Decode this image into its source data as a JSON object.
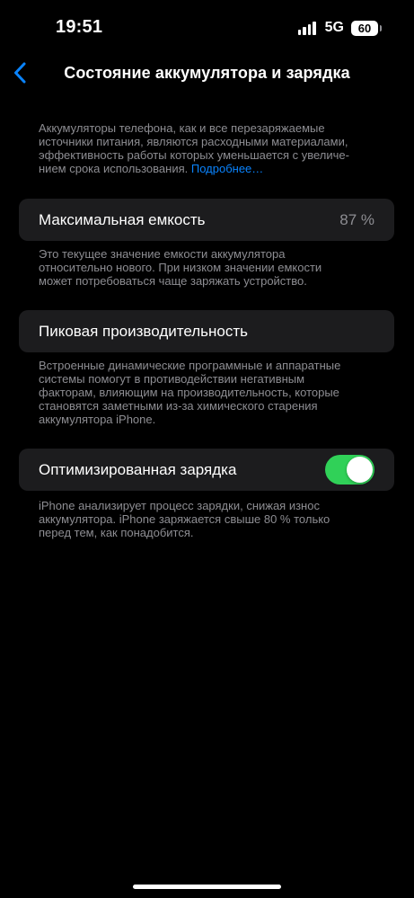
{
  "status_bar": {
    "time": "19:51",
    "network": "5G",
    "battery": "60"
  },
  "nav": {
    "back_icon": "chevron-left-icon",
    "title": "Состояние аккумулятора и зарядка"
  },
  "intro": {
    "lines": [
      "Аккумуляторы телефона, как и все перезаряжаемые",
      "источники питания, являются расходными материалами,",
      "эффективность работы которых уменьшается с увеличе-"
    ],
    "last_line": "нием срока использования.",
    "link": "Подробнее…"
  },
  "max_capacity": {
    "label": "Максимальная емкость",
    "value": "87 %",
    "note": [
      "Это текущее значение емкости аккумулятора",
      "относительно нового. При низком значении емкости",
      "может потребоваться чаще заряжать устройство."
    ]
  },
  "peak_performance": {
    "label": "Пиковая производительность",
    "note": [
      "Встроенные динамические программные и аппаратные",
      "системы помогут в противодействии негативным",
      "факторам, влияющим на производительность, которые",
      "становятся заметными из-за химического старения",
      "аккумулятора iPhone."
    ]
  },
  "optimized_charging": {
    "label": "Оптимизированная зарядка",
    "enabled": true,
    "note": [
      "iPhone анализирует процесс зарядки, снижая износ",
      "аккумулятора. iPhone заряжается свыше 80 % только",
      "перед тем, как понадобится."
    ]
  },
  "colors": {
    "accent": "#0a84ff",
    "toggle_on": "#30d158",
    "card_bg": "#1c1c1e",
    "secondary_text": "#8d8d92"
  }
}
